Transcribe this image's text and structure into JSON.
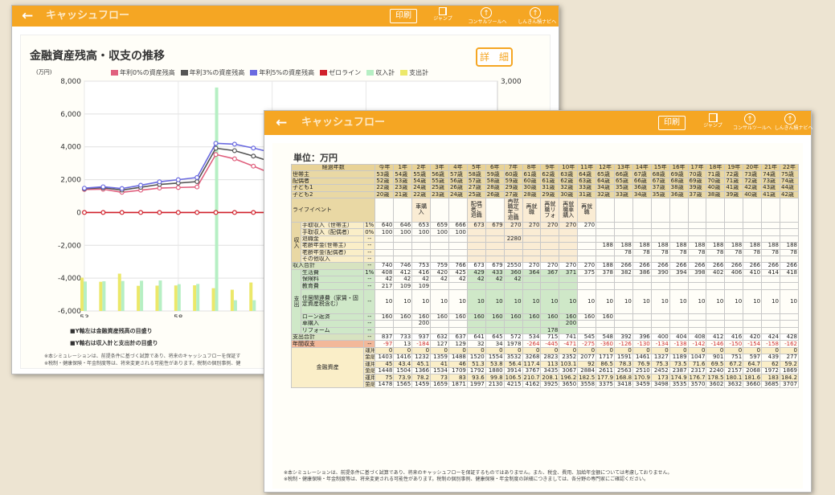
{
  "header": {
    "back": "←",
    "title": "キャッシュフロー",
    "print": "印刷",
    "jump": "ジャンプ",
    "consult": "コンサルツールへ",
    "navi": "しんきん積ナビへ"
  },
  "chart_panel": {
    "title": "金融資産残高・収支の推移",
    "detail_button": "詳　細",
    "unit": "(万円)",
    "legend": [
      {
        "label": "年利0%の資産残高",
        "color": "#e0607e"
      },
      {
        "label": "年利3%の資産残高",
        "color": "#555555"
      },
      {
        "label": "年利5%の資産残高",
        "color": "#6a6ae0"
      },
      {
        "label": "ゼロライン",
        "color": "#d0202a"
      },
      {
        "label": "収入計",
        "color": "#b6efc4"
      },
      {
        "label": "支出計",
        "color": "#ece86a"
      }
    ],
    "notes": [
      "■Y軸左は金融資産残高の目盛り",
      "■Y軸右は収入計と支出計の目盛り"
    ],
    "footnotes": [
      "※本シミュレーションは、前提条件に基づく試算であり、将来のキャッシュフローを保証す",
      "※税制・健康保険・年金制度等は、将来変更される可能性があります。税制の個別事例、健"
    ]
  },
  "chart_data": {
    "type": "line",
    "title": "金融資産残高・収支の推移",
    "y_left_range": [
      -6000,
      8000
    ],
    "y_left_ticks": [
      "8,000",
      "6,000",
      "4,000",
      "2,000",
      "0",
      "-2,000",
      "-4,000",
      "-6,000"
    ],
    "y_right_ticks": [
      "3,000"
    ],
    "x_ticks": [
      "53",
      "58",
      "63",
      "68"
    ],
    "xlim": [
      53,
      75
    ],
    "series": [
      {
        "name": "年利0%の資産残高",
        "x": [
          53,
          54,
          55,
          56,
          57,
          58,
          59,
          60,
          61,
          62,
          63,
          64,
          65,
          66,
          67,
          68,
          69,
          70,
          71,
          72,
          73,
          74,
          75
        ],
        "values": [
          1403,
          1416,
          1232,
          1359,
          1488,
          1520,
          1554,
          3532,
          3268,
          2823,
          2352,
          2077,
          1717,
          1591,
          1461,
          1327,
          1189,
          1047,
          901,
          751,
          597,
          439,
          277
        ]
      },
      {
        "name": "年利3%の資産残高",
        "x": [
          53,
          54,
          55,
          56,
          57,
          58,
          59,
          60,
          61,
          62,
          63,
          64,
          65,
          66,
          67,
          68,
          69,
          70,
          71,
          72,
          73,
          74,
          75
        ],
        "values": [
          1448,
          1504,
          1366,
          1534,
          1709,
          1792,
          1880,
          3914,
          3767,
          3435,
          3067,
          2884,
          2611,
          2563,
          2510,
          2452,
          2387,
          2317,
          2240,
          2157,
          2068,
          1972,
          1869
        ]
      },
      {
        "name": "年利5%の資産残高",
        "x": [
          53,
          54,
          55,
          56,
          57,
          58,
          59,
          60,
          61,
          62,
          63,
          64,
          65,
          66,
          67,
          68,
          69,
          70,
          71,
          72,
          73,
          74,
          75
        ],
        "values": [
          1478,
          1565,
          1459,
          1659,
          1871,
          1997,
          2130,
          4215,
          4162,
          3925,
          3650,
          3558,
          3375,
          3418,
          3459,
          3498,
          3535,
          3570,
          3602,
          3632,
          3660,
          3685,
          3707
        ]
      },
      {
        "name": "ゼロライン",
        "x": [
          53,
          54,
          55,
          56,
          57,
          58,
          59,
          60,
          61,
          62,
          63,
          64,
          65,
          66,
          67,
          68,
          69,
          70,
          71,
          72,
          73,
          74,
          75
        ],
        "values": [
          0,
          0,
          0,
          0,
          0,
          0,
          0,
          0,
          0,
          0,
          0,
          0,
          0,
          0,
          0,
          0,
          0,
          0,
          0,
          0,
          0,
          0,
          0
        ]
      },
      {
        "name": "収入計",
        "x": [
          53,
          54,
          55,
          56,
          57,
          58,
          59,
          60,
          61,
          62,
          63,
          64,
          65,
          66,
          67,
          68,
          69,
          70,
          71,
          72,
          73,
          74,
          75
        ],
        "values": [
          740,
          746,
          753,
          759,
          766,
          673,
          679,
          2550,
          270,
          270,
          270,
          270,
          188,
          266,
          266,
          266,
          266,
          266,
          266,
          266,
          266,
          266,
          266
        ]
      },
      {
        "name": "支出計",
        "x": [
          53,
          54,
          55,
          56,
          57,
          58,
          59,
          60,
          61,
          62,
          63,
          64,
          65,
          66,
          67,
          68,
          69,
          70,
          71,
          72,
          73,
          74,
          75
        ],
        "values": [
          837,
          733,
          937,
          632,
          637,
          641,
          645,
          572,
          534,
          715,
          741,
          545,
          548,
          392,
          396,
          400,
          404,
          408,
          412,
          416,
          420,
          424,
          428
        ]
      }
    ]
  },
  "table": {
    "unit_label": "単位：万円",
    "years": [
      "今年",
      "1年",
      "2年",
      "3年",
      "4年",
      "5年",
      "6年",
      "7年",
      "8年",
      "9年",
      "10年",
      "11年",
      "12年",
      "13年",
      "14年",
      "15年",
      "16年",
      "17年",
      "18年",
      "19年",
      "20年",
      "21年",
      "22年"
    ],
    "elapsed_label": "経過年数",
    "ages": [
      {
        "label": "世帯主",
        "values": [
          "53歳",
          "54歳",
          "55歳",
          "56歳",
          "57歳",
          "58歳",
          "59歳",
          "60歳",
          "61歳",
          "62歳",
          "63歳",
          "64歳",
          "65歳",
          "66歳",
          "67歳",
          "68歳",
          "69歳",
          "70歳",
          "71歳",
          "72歳",
          "73歳",
          "74歳",
          "75歳"
        ]
      },
      {
        "label": "配偶者",
        "values": [
          "52歳",
          "53歳",
          "54歳",
          "55歳",
          "56歳",
          "57歳",
          "58歳",
          "59歳",
          "60歳",
          "61歳",
          "62歳",
          "63歳",
          "64歳",
          "65歳",
          "66歳",
          "67歳",
          "68歳",
          "69歳",
          "70歳",
          "71歳",
          "72歳",
          "73歳",
          "74歳"
        ]
      },
      {
        "label": "子ども1",
        "values": [
          "22歳",
          "23歳",
          "24歳",
          "25歳",
          "26歳",
          "27歳",
          "28歳",
          "29歳",
          "30歳",
          "31歳",
          "32歳",
          "33歳",
          "34歳",
          "35歳",
          "36歳",
          "37歳",
          "38歳",
          "39歳",
          "40歳",
          "41歳",
          "42歳",
          "43歳",
          "44歳"
        ]
      },
      {
        "label": "子ども2",
        "values": [
          "20歳",
          "21歳",
          "22歳",
          "23歳",
          "24歳",
          "25歳",
          "26歳",
          "27歳",
          "28歳",
          "29歳",
          "30歳",
          "31歳",
          "32歳",
          "33歳",
          "34歳",
          "35歳",
          "36歳",
          "37歳",
          "38歳",
          "39歳",
          "40歳",
          "41歳",
          "42歳"
        ]
      }
    ],
    "events_label": "ライフイベント",
    "events": [
      "",
      "",
      "車購入",
      "",
      "",
      "配偶者ご退職",
      "",
      "再就職定年ご退職",
      "再就職",
      "再就職リフォ",
      "再就職車購入",
      "再就職",
      "",
      "",
      "",
      "",
      "",
      "",
      "",
      "",
      "",
      "",
      ""
    ],
    "income_label": "収入",
    "income": [
      {
        "label": "手取収入（世帯主）",
        "rate": "1%",
        "values": [
          "640",
          "646",
          "653",
          "659",
          "666",
          "673",
          "679",
          "270",
          "270",
          "270",
          "270",
          "270",
          "",
          "",
          "",
          "",
          "",
          "",
          "",
          "",
          "",
          "",
          ""
        ]
      },
      {
        "label": "手取収入（配偶者）",
        "rate": "0%",
        "values": [
          "100",
          "100",
          "100",
          "100",
          "100",
          "",
          "",
          "",
          "",
          "",
          "",
          "",
          "",
          "",
          "",
          "",
          "",
          "",
          "",
          "",
          "",
          "",
          ""
        ]
      },
      {
        "label": "退職金",
        "rate": "--",
        "values": [
          "",
          "",
          "",
          "",
          "",
          "",
          "",
          "2280",
          "",
          "",
          "",
          "",
          "",
          "",
          "",
          "",
          "",
          "",
          "",
          "",
          "",
          "",
          ""
        ]
      },
      {
        "label": "老齢年金(世帯主)",
        "rate": "--",
        "values": [
          "",
          "",
          "",
          "",
          "",
          "",
          "",
          "",
          "",
          "",
          "",
          "",
          "188",
          "188",
          "188",
          "188",
          "188",
          "188",
          "188",
          "188",
          "188",
          "188",
          "188"
        ]
      },
      {
        "label": "老齢年金(配偶者)",
        "rate": "--",
        "values": [
          "",
          "",
          "",
          "",
          "",
          "",
          "",
          "",
          "",
          "",
          "",
          "",
          "",
          "78",
          "78",
          "78",
          "78",
          "78",
          "78",
          "78",
          "78",
          "78",
          "78"
        ]
      },
      {
        "label": "その他収入",
        "rate": "--",
        "values": [
          "",
          "",
          "",
          "",
          "",
          "",
          "",
          "",
          "",
          "",
          "",
          "",
          "",
          "",
          "",
          "",
          "",
          "",
          "",
          "",
          "",
          "",
          ""
        ]
      }
    ],
    "income_total": {
      "label": "収入合計",
      "rate": "--",
      "values": [
        "740",
        "746",
        "753",
        "759",
        "766",
        "673",
        "679",
        "2550",
        "270",
        "270",
        "270",
        "270",
        "188",
        "266",
        "266",
        "266",
        "266",
        "266",
        "266",
        "266",
        "266",
        "266",
        "266"
      ]
    },
    "expense_label": "支出",
    "expense": [
      {
        "label": "生活費",
        "rate": "1%",
        "values": [
          "408",
          "412",
          "416",
          "420",
          "425",
          "429",
          "433",
          "360",
          "364",
          "367",
          "371",
          "375",
          "378",
          "382",
          "386",
          "390",
          "394",
          "398",
          "402",
          "406",
          "410",
          "414",
          "418"
        ]
      },
      {
        "label": "保険料",
        "rate": "--",
        "values": [
          "42",
          "42",
          "42",
          "42",
          "42",
          "42",
          "42",
          "42",
          "",
          "",
          "",
          "",
          "",
          "",
          "",
          "",
          "",
          "",
          "",
          "",
          "",
          "",
          ""
        ]
      },
      {
        "label": "教育費",
        "rate": "--",
        "values": [
          "217",
          "109",
          "109",
          "",
          "",
          "",
          "",
          "",
          "",
          "",
          "",
          "",
          "",
          "",
          "",
          "",
          "",
          "",
          "",
          "",
          "",
          "",
          ""
        ]
      },
      {
        "label": "住居関連費（家賃・固定資産税含む）",
        "rate": "--",
        "values": [
          "10",
          "10",
          "10",
          "10",
          "10",
          "10",
          "10",
          "10",
          "10",
          "10",
          "10",
          "10",
          "10",
          "10",
          "10",
          "10",
          "10",
          "10",
          "10",
          "10",
          "10",
          "10",
          "10"
        ]
      },
      {
        "label": "ローン返済",
        "rate": "--",
        "values": [
          "160",
          "160",
          "160",
          "160",
          "160",
          "160",
          "160",
          "160",
          "160",
          "160",
          "160",
          "160",
          "160",
          "",
          "",
          "",
          "",
          "",
          "",
          "",
          "",
          "",
          ""
        ]
      },
      {
        "label": "車購入",
        "rate": "--",
        "values": [
          "",
          "",
          "200",
          "",
          "",
          "",
          "",
          "",
          "",
          "",
          "200",
          "",
          "",
          "",
          "",
          "",
          "",
          "",
          "",
          "",
          "",
          "",
          ""
        ]
      },
      {
        "label": "リフォーム",
        "rate": "--",
        "values": [
          "",
          "",
          "",
          "",
          "",
          "",
          "",
          "",
          "",
          "178",
          "",
          "",
          "",
          "",
          "",
          "",
          "",
          "",
          "",
          "",
          "",
          "",
          ""
        ]
      }
    ],
    "expense_total": {
      "label": "支出合計",
      "rate": "--",
      "values": [
        "837",
        "733",
        "937",
        "632",
        "637",
        "641",
        "645",
        "572",
        "534",
        "715",
        "741",
        "545",
        "548",
        "392",
        "396",
        "400",
        "404",
        "408",
        "412",
        "416",
        "420",
        "424",
        "428"
      ]
    },
    "net": {
      "label": "年間収支",
      "rate": "--",
      "values": [
        "-97",
        "13",
        "-184",
        "127",
        "129",
        "32",
        "34",
        "1978",
        "-264",
        "-445",
        "-471",
        "-275",
        "-360",
        "-126",
        "-130",
        "-134",
        "-138",
        "-142",
        "-146",
        "-150",
        "-154",
        "-158",
        "-162"
      ]
    },
    "assets_label": "金融資産",
    "assets": [
      {
        "label": "運用益0%",
        "values": [
          "0",
          "0",
          "0",
          "0",
          "0",
          "0",
          "0",
          "0",
          "0",
          "0",
          "0",
          "0",
          "0",
          "0",
          "0",
          "0",
          "0",
          "0",
          "0",
          "0",
          "0",
          "0",
          "0"
        ]
      },
      {
        "label": "金融資産残高",
        "values": [
          "1403",
          "1416",
          "1232",
          "1359",
          "1488",
          "1520",
          "1554",
          "3532",
          "3268",
          "2823",
          "2352",
          "2077",
          "1717",
          "1591",
          "1461",
          "1327",
          "1189",
          "1047",
          "901",
          "751",
          "597",
          "439",
          "277"
        ]
      },
      {
        "label": "運用益3%",
        "values": [
          "45",
          "43.4",
          "45.1",
          "41",
          "46",
          "51.3",
          "53.8",
          "56.4",
          "117.4",
          "113",
          "103.1",
          "92",
          "86.5",
          "78.3",
          "76.9",
          "75.3",
          "73.5",
          "71.6",
          "69.5",
          "67.2",
          "64.7",
          "62",
          "59.2"
        ]
      },
      {
        "label": "金融資産残高",
        "values": [
          "1448",
          "1504",
          "1366",
          "1534",
          "1709",
          "1792",
          "1880",
          "3914",
          "3767",
          "3435",
          "3067",
          "2884",
          "2611",
          "2563",
          "2510",
          "2452",
          "2387",
          "2317",
          "2240",
          "2157",
          "2068",
          "1972",
          "1869"
        ]
      },
      {
        "label": "運用益5%",
        "values": [
          "75",
          "73.9",
          "78.2",
          "73",
          "83",
          "93.6",
          "99.8",
          "106.5",
          "210.7",
          "208.1",
          "196.2",
          "182.5",
          "177.9",
          "168.8",
          "170.9",
          "173",
          "174.9",
          "176.7",
          "178.5",
          "180.1",
          "181.6",
          "183",
          "184.2"
        ]
      },
      {
        "label": "金融資産残高",
        "values": [
          "1478",
          "1565",
          "1459",
          "1659",
          "1871",
          "1997",
          "2130",
          "4215",
          "4162",
          "3925",
          "3650",
          "3558",
          "3375",
          "3418",
          "3459",
          "3498",
          "3535",
          "3570",
          "3602",
          "3632",
          "3660",
          "3685",
          "3707"
        ]
      }
    ],
    "footnotes": [
      "※本シミュレーションは、前提条件に基づく試算であり、将来のキャッシュフローを保証するものではありません。また、税金、費用、加給年金額については考慮しておりません。",
      "※税制・健康保険・年金制度等は、将来変更される可能性があります。税制の個別事例、健康保険・年金制度の詳細につきましては、各分野の専門家にご確認ください。"
    ]
  }
}
